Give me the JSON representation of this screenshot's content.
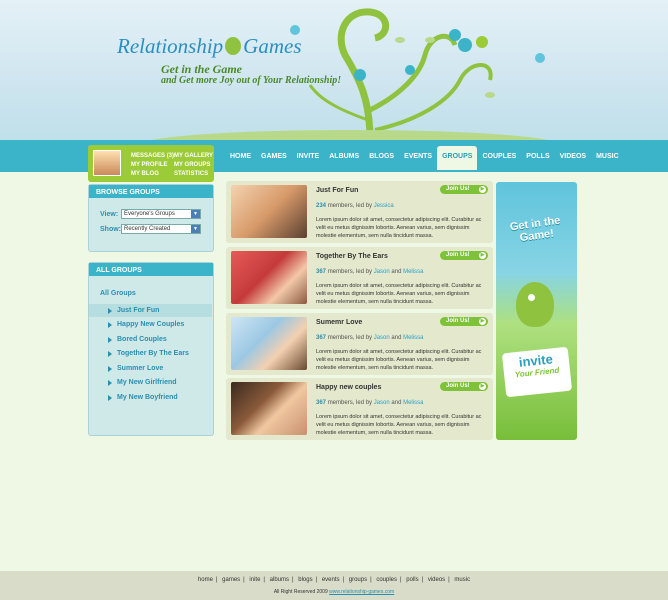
{
  "header": {
    "logo_part1": "Relationship",
    "logo_part2": "Games",
    "tagline1": "Get in the Game",
    "tagline2": "and Get more Joy out of Your Relationship!"
  },
  "nav": [
    "HOME",
    "GAMES",
    "INVITE",
    "ALBUMS",
    "BLOGS",
    "EVENTS",
    "GROUPS",
    "COUPLES",
    "POLLS",
    "VIDEOS",
    "MUSIC"
  ],
  "nav_active": "GROUPS",
  "profile": {
    "messages": "MESSAGES",
    "messages_count": "(3)",
    "gallery": "MY GALLERY",
    "profile": "MY PROFILE",
    "groups": "MY GROUPS",
    "blog": "MY BLOG",
    "statistics": "STATISTICS"
  },
  "browse": {
    "title": "BROWSE GROUPS",
    "view_label": "View:",
    "view_value": "Everyone's Groups",
    "show_label": "Show:",
    "show_value": "Recently Created"
  },
  "all_groups": {
    "title": "ALL GROUPS",
    "heading": "All Groups",
    "items": [
      "Just For Fun",
      "Happy New Couples",
      "Bored Couples",
      "Together By The Ears",
      "Summer Love",
      "My New Girlfriend",
      "My New Boyfriend"
    ],
    "selected": "Just For Fun"
  },
  "groups": [
    {
      "title": "Just For Fun",
      "count": "234",
      "members_text": "members, led by",
      "leader1": "Jessica",
      "leader2": "",
      "and": "",
      "join": "Join Us!",
      "description": "Lorem ipsum dolor sit amet, consectetur adipiscing elit. Curabitur ac velit eu metus dignissim lobortis. Aenean varius, sem dignissim molestie elementum, sem nulla tincidunt massa."
    },
    {
      "title": "Together By The Ears",
      "count": "367",
      "members_text": "members, led by",
      "leader1": "Jason",
      "leader2": "Melissa",
      "and": "and",
      "join": "Join Us!",
      "description": "Lorem ipsum dolor sit amet, consectetur adipiscing elit. Curabitur ac velit eu metus dignissim lobortis. Aenean varius, sem dignissim molestie elementum, sem nulla tincidunt massa."
    },
    {
      "title": "Sumemr Love",
      "count": "367",
      "members_text": "members, led by",
      "leader1": "Jason",
      "leader2": "Melissa",
      "and": "and",
      "join": "Join Us!",
      "description": "Lorem ipsum dolor sit amet, consectetur adipiscing elit. Curabitur ac velit eu metus dignissim lobortis. Aenean varius, sem dignissim molestie elementum, sem nulla tincidunt massa."
    },
    {
      "title": "Happy new couples",
      "count": "367",
      "members_text": "members, led by",
      "leader1": "Jason",
      "leader2": "Melissa",
      "and": "and",
      "join": "Join Us!",
      "description": "Lorem ipsum dolor sit amet, consectetur adipiscing elit. Curabitur ac velit eu metus dignissim lobortis. Aenean varius, sem dignissim molestie elementum, sem nulla tincidunt massa."
    }
  ],
  "banner": {
    "top": "Get in the Game!",
    "invite": "invite",
    "your_friend": "Your Friend"
  },
  "footer": {
    "links": [
      "home",
      "games",
      "inite",
      "albums",
      "blogs",
      "events",
      "groups",
      "couples",
      "polls",
      "videos",
      "music"
    ],
    "copyright": "All Right Reserved 2009",
    "site": "www.relationship-games.com"
  },
  "colors": {
    "accent": "#3bb4c9",
    "green": "#9bcb36",
    "link": "#2a8fb0",
    "card_bg": "#e4e8cc",
    "page_bg": "#eef8e4"
  }
}
